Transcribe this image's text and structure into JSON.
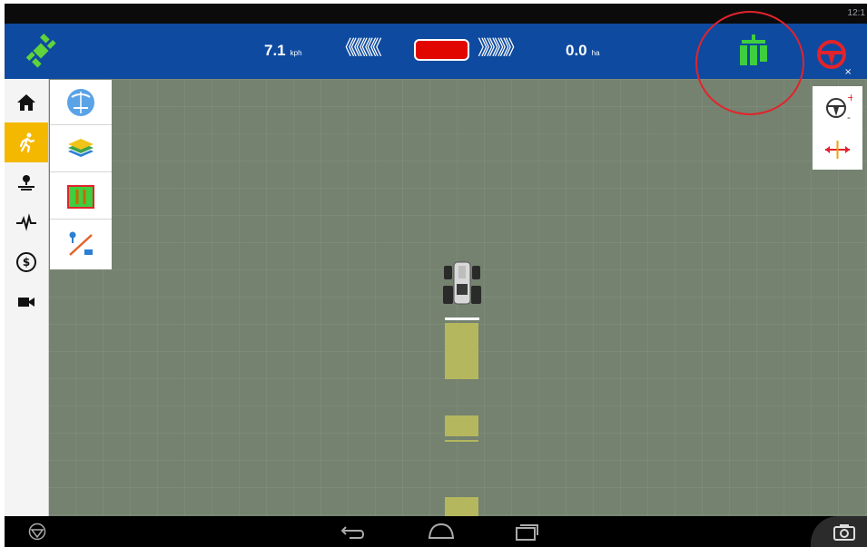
{
  "status_bar": {
    "clock": "12:1"
  },
  "top_bar": {
    "speed_value": "7.1",
    "speed_unit": "kph",
    "left_chevrons": "《《《《《《",
    "right_chevrons": "》》》》》》",
    "area_value": "0.0",
    "area_unit": "ha",
    "guidance_color": "#e10600",
    "section_control_color": "#3fce3f",
    "highlight_color": "#e3232b"
  },
  "sidebar": {
    "items": [
      {
        "icon": "home-icon"
      },
      {
        "icon": "running-man-icon",
        "active": true
      },
      {
        "icon": "map-pin-icon"
      },
      {
        "icon": "pulse-icon"
      },
      {
        "icon": "dollar-coin-icon"
      },
      {
        "icon": "video-camera-icon"
      }
    ]
  },
  "flyout": {
    "items": [
      {
        "icon": "field-globe-icon"
      },
      {
        "icon": "layers-icon"
      },
      {
        "icon": "guidance-lines-icon"
      },
      {
        "icon": "boundary-marker-icon"
      }
    ]
  },
  "right_panel": {
    "items": [
      {
        "icon": "steering-sensitivity-icon"
      },
      {
        "icon": "nudge-icon"
      }
    ]
  },
  "nav_bar": {
    "items": [
      "brand-logo-icon",
      "back-icon",
      "home-icon",
      "recent-apps-icon",
      "screenshot-camera-icon"
    ]
  }
}
